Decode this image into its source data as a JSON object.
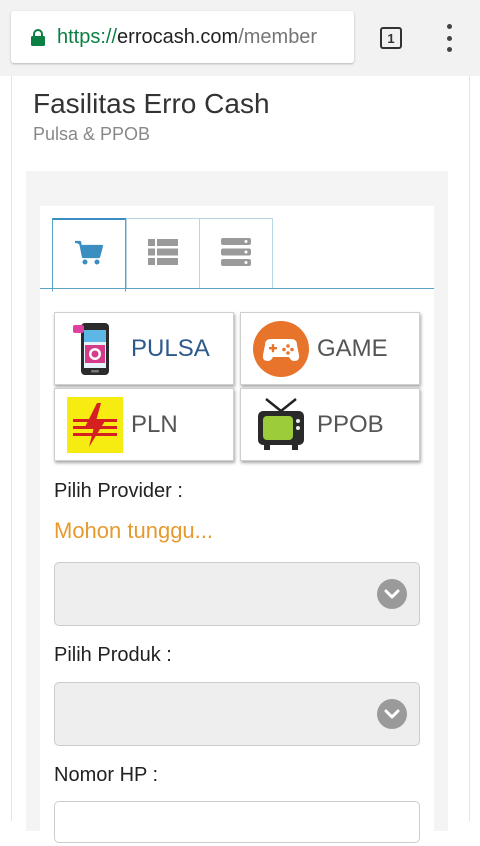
{
  "browser": {
    "url_scheme": "https://",
    "url_host": "errocash.com",
    "url_path": "/member",
    "tab_count": "1"
  },
  "page": {
    "title": "Fasilitas Erro Cash",
    "subtitle": "Pulsa & PPOB"
  },
  "tabs": [
    {
      "icon": "cart-icon",
      "active": true
    },
    {
      "icon": "list-icon",
      "active": false
    },
    {
      "icon": "server-icon",
      "active": false
    }
  ],
  "services": [
    {
      "label": "PULSA",
      "icon": "phone-icon"
    },
    {
      "label": "GAME",
      "icon": "gamepad-icon"
    },
    {
      "label": "PLN",
      "icon": "electricity-icon"
    },
    {
      "label": "PPOB",
      "icon": "tv-icon"
    }
  ],
  "form": {
    "provider_label": "Pilih Provider :",
    "loading_text": "Mohon tunggu...",
    "product_label": "Pilih Produk :",
    "phone_label": "Nomor HP :"
  },
  "colors": {
    "accent": "#59a4c6",
    "loading": "#e69a2e",
    "secure": "#0b8043"
  }
}
